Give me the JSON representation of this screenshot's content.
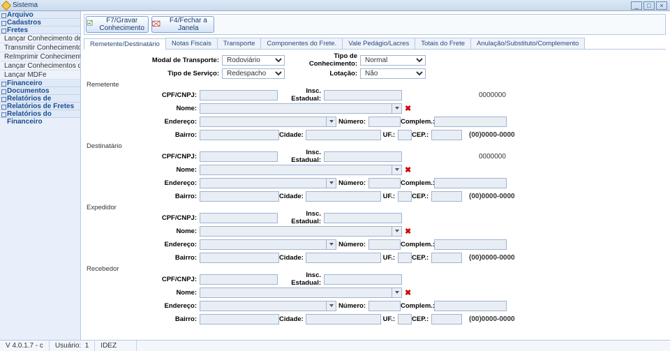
{
  "title": "Sistema",
  "winbtns": {
    "min": "_",
    "max": "□",
    "close": "×"
  },
  "sidebar": {
    "groups": [
      {
        "label": "Arquivo",
        "items": []
      },
      {
        "label": "Cadastros",
        "items": []
      },
      {
        "label": "Fretes",
        "items": [
          "Lançar Conhecimento de Frete",
          "Transmitir Conhecimentos de Frete",
          "ReImprimir Conhecimentos de Frete",
          "Lançar Conhecimentos de Terceiros",
          "Lançar MDFe"
        ]
      },
      {
        "label": "Financeiro",
        "items": []
      },
      {
        "label": "Documentos",
        "items": []
      },
      {
        "label": "Relatórios de Cadastros",
        "items": []
      },
      {
        "label": "Relatórios de Fretes",
        "items": []
      },
      {
        "label": "Relatórios do Financeiro",
        "items": []
      }
    ]
  },
  "toolbar": {
    "save": "F7/Gravar Conhecimento",
    "close": "F4/Fechar a Janela"
  },
  "tabs": [
    "Remetente/Destinatário",
    "Notas Fiscais",
    "Transporte",
    "Componentes do Frete.",
    "Vale Pedágio/Lacres",
    "Totais do Frete",
    "Anulação/Substituto/Complemento"
  ],
  "activeTab": 0,
  "header": {
    "modalLabel": "Modal de Transporte:",
    "modalValue": "Rodoviário",
    "tipoConLabel": "Tipo de Conhecimento:",
    "tipoConValue": "Normal",
    "tipoServLabel": "Tipo de Serviço:",
    "tipoServValue": "Redespacho",
    "lotacaoLabel": "Lotação:",
    "lotacaoValue": "Não"
  },
  "labels": {
    "cpf": "CPF/CNPJ:",
    "insc": "Insc. Estadual:",
    "nome": "Nome:",
    "endereco": "Endereço:",
    "numero": "Número:",
    "complem": "Complem.:",
    "bairro": "Bairro:",
    "cidade": "Cidade:",
    "uf": "UF.:",
    "cep": "CEP.:"
  },
  "sections": [
    {
      "title": "Remetente",
      "code": "0000000",
      "phone": "(00)0000-0000",
      "hasRedX": true
    },
    {
      "title": "Destinatário",
      "code": "0000000",
      "phone": "(00)0000-0000",
      "hasRedX": true
    },
    {
      "title": "Expedidor",
      "code": "",
      "phone": "(00)0000-0000",
      "hasRedX": true
    },
    {
      "title": "Recebedor",
      "code": "",
      "phone": "(00)0000-0000",
      "hasRedX": true
    }
  ],
  "status": {
    "version": "V 4.0.1.7 - c",
    "userLabel": "Usuário:",
    "userId": "1",
    "userName": "IDEZ"
  }
}
